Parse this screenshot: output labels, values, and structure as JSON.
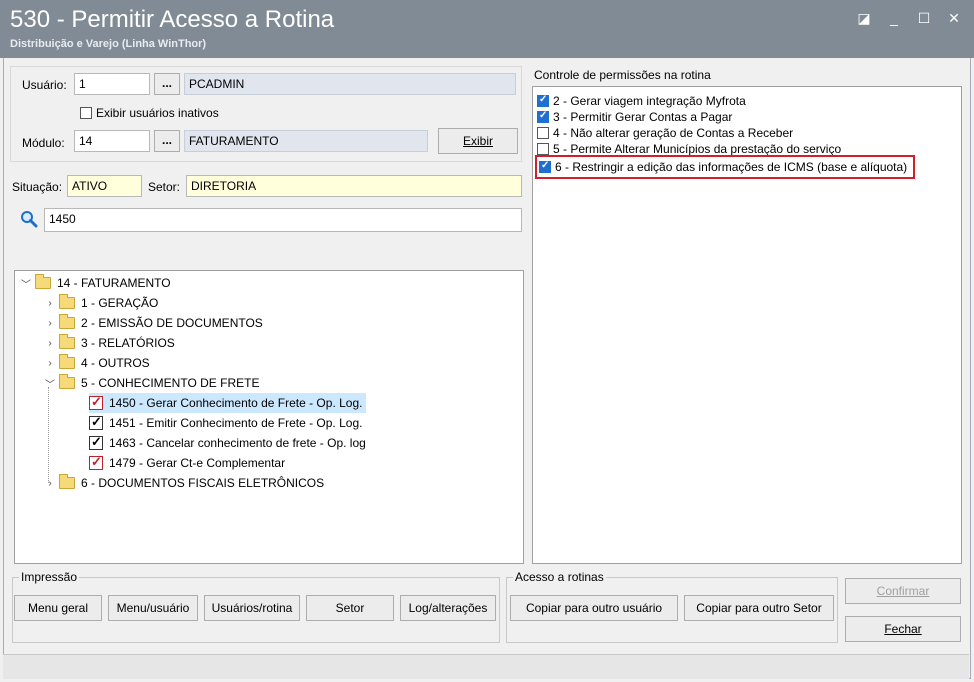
{
  "window": {
    "title": "530 - Permitir Acesso a Rotina",
    "subtitle": "Distribuição e Varejo (Linha WinThor)",
    "controls": [
      "◪",
      "_",
      "☐",
      "✕"
    ]
  },
  "user": {
    "label": "Usuário:",
    "code": "1",
    "browse": "...",
    "name": "PCADMIN",
    "show_inactive_label": "Exibir usuários inativos"
  },
  "module": {
    "label": "Módulo:",
    "code": "14",
    "browse": "...",
    "name": "FATURAMENTO",
    "show_button": "Exibir"
  },
  "situation": {
    "label": "Situação:",
    "value": "ATIVO"
  },
  "sector": {
    "label": "Setor:",
    "value": "DIRETORIA"
  },
  "search": {
    "icon": "search-icon",
    "value": "1450"
  },
  "tree": {
    "root": "14 - FATURAMENTO",
    "folders": [
      "1 - GERAÇÃO",
      "2 - EMISSÃO DE DOCUMENTOS",
      "3 - RELATÓRIOS",
      "4 - OUTROS",
      "5 - CONHECIMENTO DE FRETE"
    ],
    "routines": [
      "1450 - Gerar Conhecimento de Frete - Op. Log.",
      "1451 - Emitir Conhecimento de Frete - Op. Log.",
      "1463 - Cancelar conhecimento de frete - Op. log",
      "1479 - Gerar Ct-e Complementar"
    ],
    "last_folder": "6 - DOCUMENTOS FISCAIS ELETRÔNICOS"
  },
  "permissions": {
    "title": "Controle de permissões na rotina",
    "items": [
      {
        "label": "2 - Gerar viagem integração Myfrota",
        "checked": true
      },
      {
        "label": "3 - Permitir Gerar Contas a Pagar",
        "checked": true
      },
      {
        "label": "4 - Não alterar geração de Contas a Receber",
        "checked": false
      },
      {
        "label": "5 - Permite Alterar Municípios da prestação do serviço",
        "checked": false
      },
      {
        "label": "6 - Restringir a edição das informações de ICMS (base e alíquota)",
        "checked": true
      }
    ]
  },
  "print": {
    "title": "Impressão",
    "buttons": [
      "Menu geral",
      "Menu/usuário",
      "Usuários/rotina",
      "Setor",
      "Log/alterações"
    ]
  },
  "access": {
    "title": "Acesso a rotinas",
    "buttons": [
      "Copiar para outro usuário",
      "Copiar para outro Setor"
    ]
  },
  "actions": {
    "confirm": "Confirmar",
    "close": "Fechar"
  },
  "colors": {
    "titlebar": "#818b95",
    "highlight": "#cce8ff",
    "red_outline": "#d0202a"
  }
}
